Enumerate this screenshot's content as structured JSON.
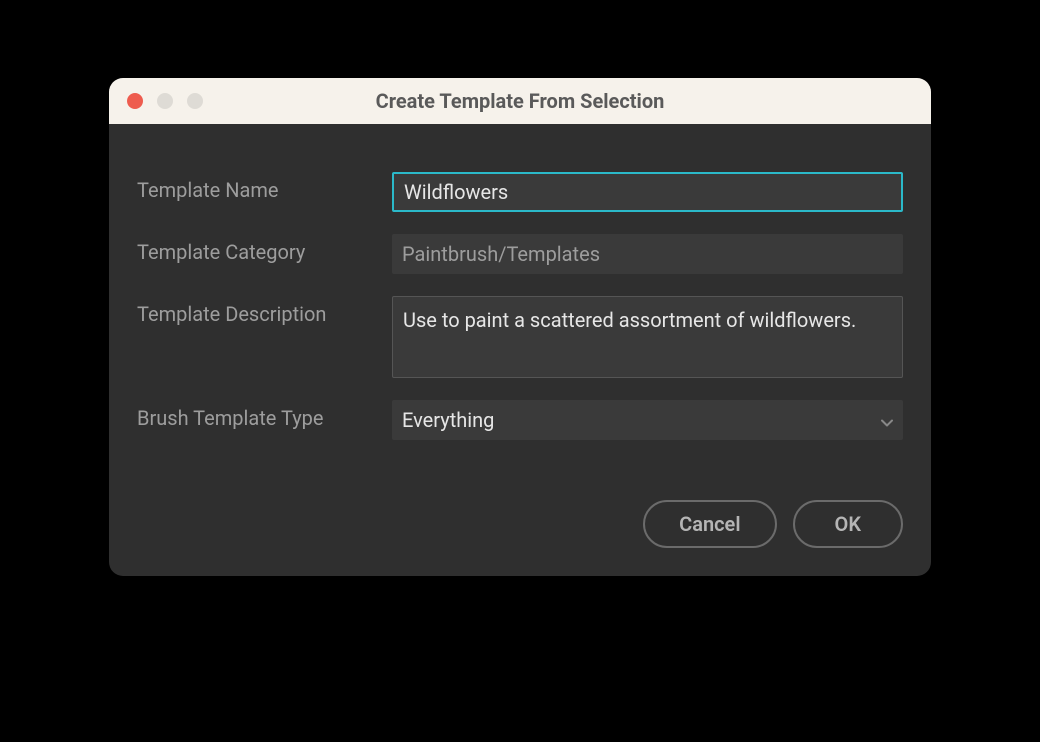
{
  "dialog": {
    "title": "Create Template From Selection",
    "labels": {
      "template_name": "Template Name",
      "template_category": "Template Category",
      "template_description": "Template Description",
      "brush_template_type": "Brush Template Type"
    },
    "fields": {
      "template_name_value": "Wildflowers",
      "template_category_value": "Paintbrush/Templates",
      "template_description_value": "Use to paint a scattered assortment of wildflowers.",
      "brush_template_type_value": "Everything"
    },
    "buttons": {
      "cancel": "Cancel",
      "ok": "OK"
    }
  }
}
